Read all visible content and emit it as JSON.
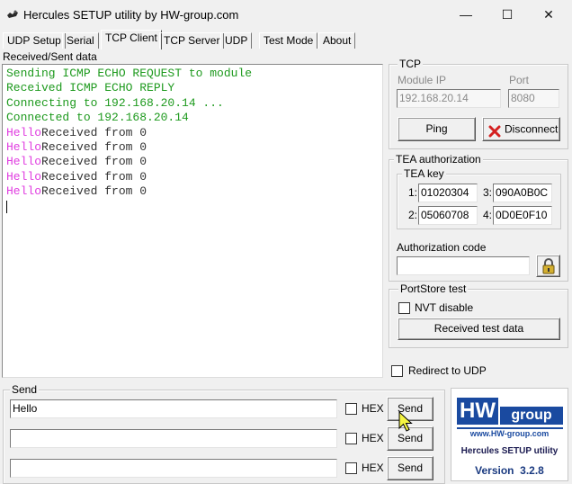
{
  "window": {
    "title": "Hercules SETUP utility by HW-group.com",
    "minimize": "—",
    "maximize": "☐",
    "close": "✕"
  },
  "tabs": [
    {
      "label": "UDP Setup",
      "active": false
    },
    {
      "label": "Serial",
      "active": false
    },
    {
      "label": "TCP Client",
      "active": true
    },
    {
      "label": "TCP Server",
      "active": false
    },
    {
      "label": "UDP",
      "active": false
    },
    {
      "label": "Test Mode",
      "active": false
    },
    {
      "label": "About",
      "active": false
    }
  ],
  "log": {
    "label": "Received/Sent data",
    "lines": [
      {
        "prefix": "",
        "text": "Sending ICMP ECHO REQUEST to module",
        "color": "#1e9a1e"
      },
      {
        "prefix": "",
        "text": "Received ICMP ECHO REPLY",
        "color": "#1e9a1e"
      },
      {
        "prefix": "",
        "text": "Connecting to 192.168.20.14 ...",
        "color": "#1e9a1e"
      },
      {
        "prefix": "",
        "text": "Connected to 192.168.20.14",
        "color": "#1e9a1e"
      },
      {
        "prefix": "Hello",
        "text": "Received from 0",
        "color": "#333333"
      },
      {
        "prefix": "Hello",
        "text": "Received from 0",
        "color": "#333333"
      },
      {
        "prefix": "Hello",
        "text": "Received from 0",
        "color": "#333333"
      },
      {
        "prefix": "Hello",
        "text": "Received from 0",
        "color": "#333333"
      },
      {
        "prefix": "Hello",
        "text": "Received from 0",
        "color": "#333333"
      }
    ]
  },
  "tcp": {
    "group_label": "TCP",
    "module_ip_label": "Module IP",
    "module_ip_value": "192.168.20.14",
    "port_label": "Port",
    "port_value": "8080",
    "ping_label": "Ping",
    "disconnect_label": "Disconnect"
  },
  "tea": {
    "group_label": "TEA authorization",
    "key_label": "TEA key",
    "keys": [
      {
        "index": "1:",
        "value": "01020304"
      },
      {
        "index": "2:",
        "value": "05060708"
      },
      {
        "index": "3:",
        "value": "090A0B0C"
      },
      {
        "index": "4:",
        "value": "0D0E0F10"
      }
    ],
    "auth_code_label": "Authorization code",
    "auth_code_value": ""
  },
  "portstore": {
    "group_label": "PortStore test",
    "nvt_label": "NVT disable",
    "received_test_label": "Received test data"
  },
  "redirect_label": "Redirect to UDP",
  "send": {
    "group_label": "Send",
    "rows": [
      {
        "value": "Hello",
        "hex_label": "HEX",
        "button_label": "Send"
      },
      {
        "value": "",
        "hex_label": "HEX",
        "button_label": "Send"
      },
      {
        "value": "",
        "hex_label": "HEX",
        "button_label": "Send"
      }
    ]
  },
  "branding": {
    "logo_hw": "HW",
    "logo_group": "group",
    "url": "www.HW-group.com",
    "product": "Hercules SETUP utility",
    "version": "Version  3.2.8"
  },
  "colors": {
    "log_green": "#1e9a1e",
    "log_magenta": "#e03ce0",
    "brand_blue": "#1a4aa0"
  }
}
